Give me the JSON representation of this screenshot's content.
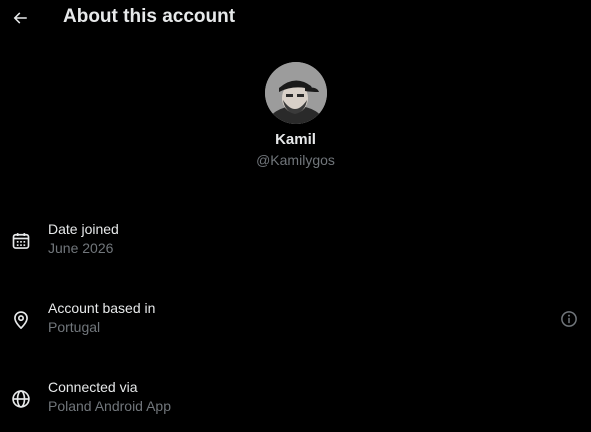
{
  "header": {
    "title": "About this account",
    "back_icon": "arrow-left-icon"
  },
  "profile": {
    "display_name": "Kamil",
    "handle": "@Kamilygos",
    "avatar": "profile-photo"
  },
  "details": [
    {
      "icon": "calendar-icon",
      "label": "Date joined",
      "value": "June 2026"
    },
    {
      "icon": "location-pin-icon",
      "label": "Account based in",
      "value": "Portugal",
      "info_icon": "info-circle-icon"
    },
    {
      "icon": "globe-icon",
      "label": "Connected via",
      "value": "Poland Android App"
    }
  ],
  "colors": {
    "background": "#000000",
    "primary_text": "#e7e9ea",
    "secondary_text": "#71767b"
  }
}
